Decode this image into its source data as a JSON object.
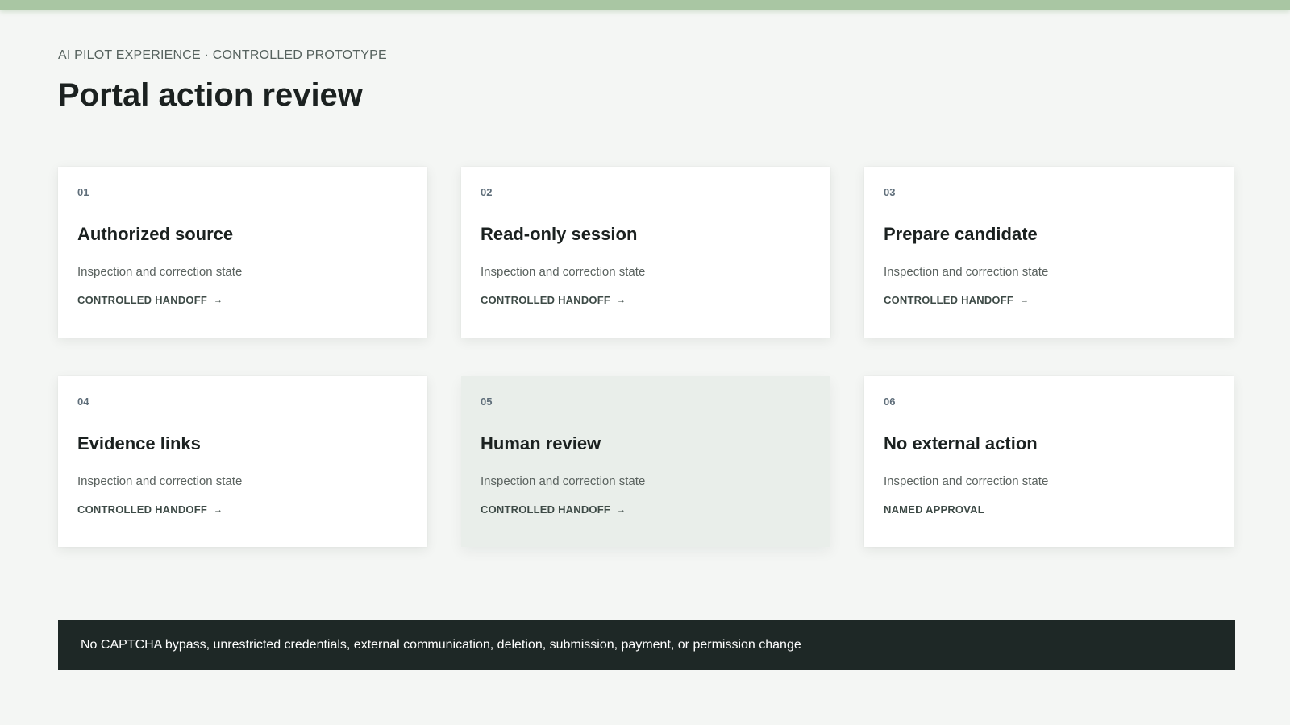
{
  "header": {
    "eyebrow": "AI PILOT EXPERIENCE · CONTROLLED PROTOTYPE",
    "title": "Portal action review"
  },
  "cards": [
    {
      "number": "01",
      "title": "Authorized source",
      "description": "Inspection and correction state",
      "link_label": "CONTROLLED HANDOFF",
      "link_icon": "→",
      "active": false
    },
    {
      "number": "02",
      "title": "Read-only session",
      "description": "Inspection and correction state",
      "link_label": "CONTROLLED HANDOFF",
      "link_icon": "→",
      "active": false
    },
    {
      "number": "03",
      "title": "Prepare candidate",
      "description": "Inspection and correction state",
      "link_label": "CONTROLLED HANDOFF",
      "link_icon": "→",
      "active": false
    },
    {
      "number": "04",
      "title": "Evidence links",
      "description": "Inspection and correction state",
      "link_label": "CONTROLLED HANDOFF",
      "link_icon": "→",
      "active": false
    },
    {
      "number": "05",
      "title": "Human review",
      "description": "Inspection and correction state",
      "link_label": "CONTROLLED HANDOFF",
      "link_icon": "→",
      "active": true
    },
    {
      "number": "06",
      "title": "No external action",
      "description": "Inspection and correction state",
      "link_label": "NAMED APPROVAL",
      "link_icon": "",
      "active": false
    }
  ],
  "footer": {
    "notice": "No CAPTCHA bypass, unrestricted credentials, external communication, deletion, submission, payment, or permission change"
  },
  "colors": {
    "accent_bar": "#a9c6a3",
    "footer_bg": "#1e2826",
    "active_card_bg": "#e9eeea"
  }
}
